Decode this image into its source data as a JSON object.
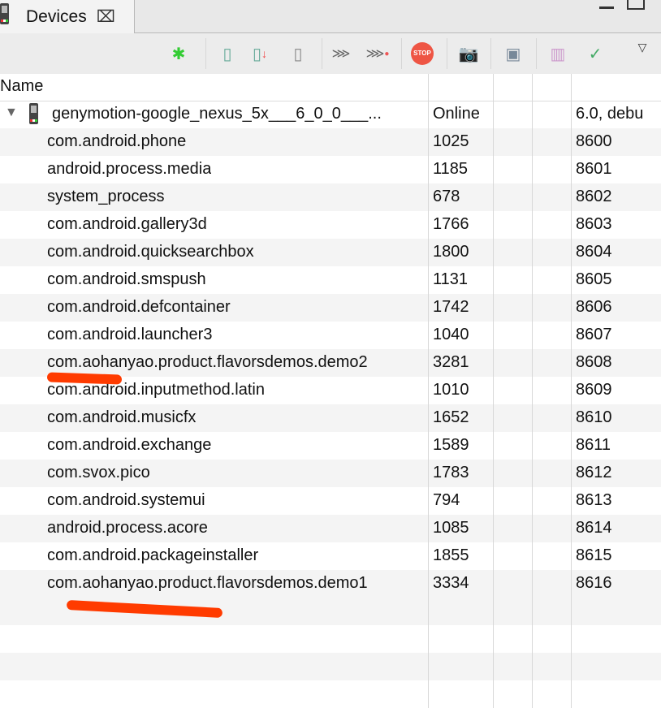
{
  "tab": {
    "title": "Devices",
    "close": "⌧"
  },
  "toolbar": {
    "icons": [
      "debug-icon",
      "update-heap-icon",
      "dump-hprof-icon",
      "cause-gc-icon",
      "update-threads-icon",
      "start-method-profiling-icon",
      "stop-process-icon",
      "screen-capture-icon",
      "systrace-icon",
      "dump-view-hierarchy-icon",
      "capture-opengl-trace-icon",
      "view-menu-icon"
    ]
  },
  "header": {
    "name": "Name"
  },
  "device": {
    "name": "genymotion-google_nexus_5x___6_0_0___...",
    "status": "Online",
    "version": "6.0, debu"
  },
  "processes": [
    {
      "name": "com.android.phone",
      "pid": "1025",
      "port": "8600"
    },
    {
      "name": "android.process.media",
      "pid": "1185",
      "port": "8601"
    },
    {
      "name": "system_process",
      "pid": "678",
      "port": "8602"
    },
    {
      "name": "com.android.gallery3d",
      "pid": "1766",
      "port": "8603"
    },
    {
      "name": "com.android.quicksearchbox",
      "pid": "1800",
      "port": "8604"
    },
    {
      "name": "com.android.smspush",
      "pid": "1131",
      "port": "8605"
    },
    {
      "name": "com.android.defcontainer",
      "pid": "1742",
      "port": "8606"
    },
    {
      "name": "com.android.launcher3",
      "pid": "1040",
      "port": "8607"
    },
    {
      "name": "com.aohanyao.product.flavorsdemos.demo2",
      "pid": "3281",
      "port": "8608"
    },
    {
      "name": "com.android.inputmethod.latin",
      "pid": "1010",
      "port": "8609"
    },
    {
      "name": "com.android.musicfx",
      "pid": "1652",
      "port": "8610"
    },
    {
      "name": "com.android.exchange",
      "pid": "1589",
      "port": "8611"
    },
    {
      "name": "com.svox.pico",
      "pid": "1783",
      "port": "8612"
    },
    {
      "name": "com.android.systemui",
      "pid": "794",
      "port": "8613"
    },
    {
      "name": "android.process.acore",
      "pid": "1085",
      "port": "8614"
    },
    {
      "name": "com.android.packageinstaller",
      "pid": "1855",
      "port": "8615"
    },
    {
      "name": "com.aohanyao.product.flavorsdemos.demo1",
      "pid": "3334",
      "port": "8616"
    }
  ]
}
